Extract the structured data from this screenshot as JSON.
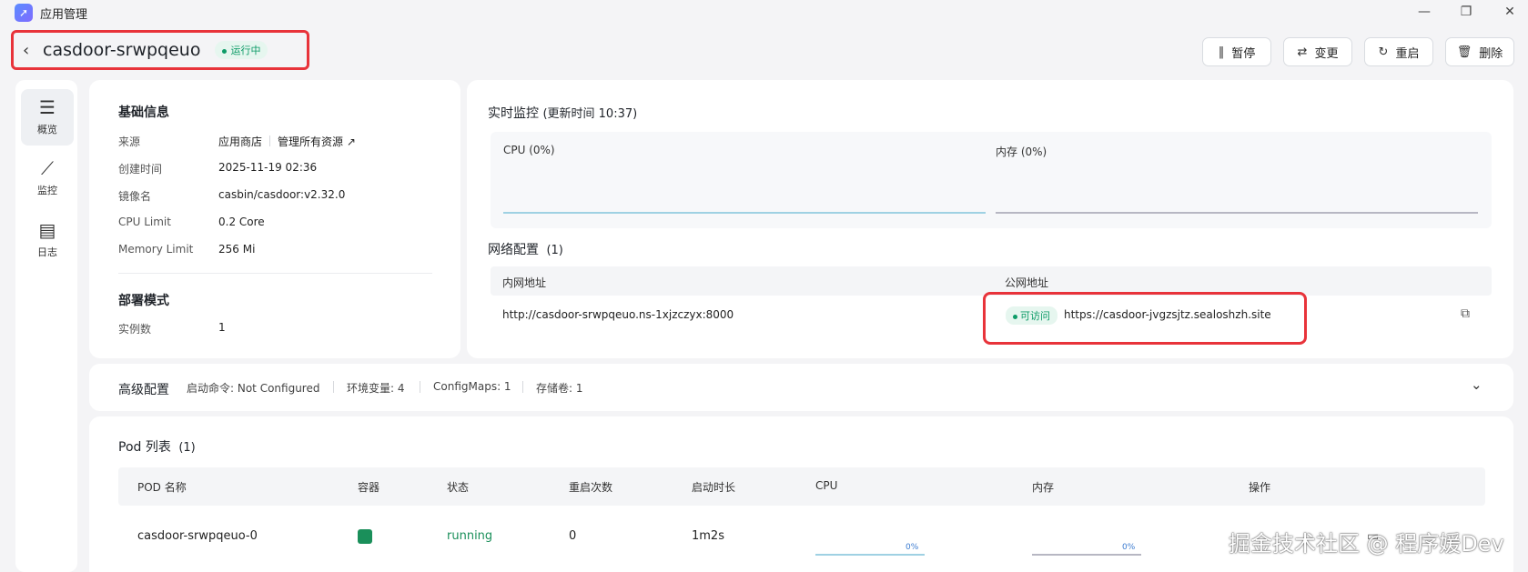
{
  "window": {
    "title": "应用管理",
    "app_icon": "rocket-icon",
    "controls": [
      "minimize-icon",
      "restore-icon",
      "close-icon"
    ]
  },
  "header": {
    "app_name": "casdoor-srwpqeuo",
    "status": "运行中",
    "status_color": "#0d9b67"
  },
  "actions": {
    "pause": "暂停",
    "change": "变更",
    "restart": "重启",
    "delete": "删除"
  },
  "sidebar": {
    "items": [
      {
        "label": "概览",
        "icon": "server-icon",
        "active": true
      },
      {
        "label": "监控",
        "icon": "line-chart-icon",
        "active": false
      },
      {
        "label": "日志",
        "icon": "calendar-log-icon",
        "active": false
      }
    ]
  },
  "basic_info": {
    "title": "基础信息",
    "source_label": "来源",
    "source_value": "应用商店",
    "manage_link": "管理所有资源 ↗",
    "created_label": "创建时间",
    "created_value": "2025-11-19 02:36",
    "image_label": "镜像名",
    "image_value": "casbin/casdoor:v2.32.0",
    "cpu_label": "CPU Limit",
    "cpu_value": "0.2 Core",
    "mem_label": "Memory Limit",
    "mem_value": "256 Mi"
  },
  "deploy": {
    "title": "部署模式",
    "replicas_label": "实例数",
    "replicas_value": "1"
  },
  "monitor": {
    "title": "实时监控",
    "update_time": "(更新时间  10:37)",
    "cpu_label": "CPU  (0%)",
    "mem_label": "内存  (0%)"
  },
  "network": {
    "title": "网络配置",
    "count": "(1)",
    "col_internal": "内网地址",
    "col_public": "公网地址",
    "internal": "http://casdoor-srwpqeuo.ns-1xjzczyx:8000",
    "access_badge": "可访问",
    "public": "https://casdoor-jvgzsjtz.sealoshzh.site"
  },
  "advanced": {
    "title": "高级配置",
    "command": "启动命令: Not Configured",
    "env": "环境变量: 4",
    "configmaps": "ConfigMaps: 1",
    "storage": "存储卷: 1"
  },
  "pods": {
    "title": "Pod 列表",
    "count": "(1)",
    "columns": [
      "POD 名称",
      "容器",
      "状态",
      "重启次数",
      "启动时长",
      "CPU",
      "内存",
      "操作"
    ],
    "rows": [
      {
        "name": "casdoor-srwpqeuo-0",
        "status": "running",
        "restarts": "0",
        "uptime": "1m2s",
        "cpu": "0%",
        "mem": "0%",
        "container_color": "#1a8f5a"
      }
    ]
  },
  "watermark": "掘金技术社区 @ 程序媛Dev"
}
